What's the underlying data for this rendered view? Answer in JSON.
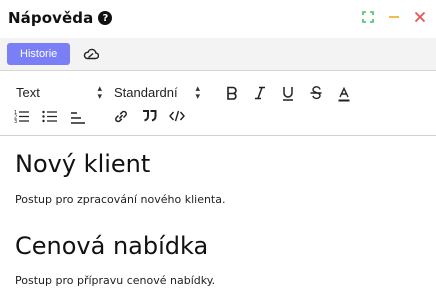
{
  "window": {
    "title": "Nápověda",
    "help_glyph": "?",
    "controls": [
      "expand-icon",
      "minimize-icon",
      "close-icon"
    ],
    "colors": {
      "expand": "#3cc46b",
      "minimize": "#f2b43a",
      "close": "#e8534f"
    }
  },
  "tabbar": {
    "history_label": "Historie",
    "cloud_icon": "cloud-icon",
    "accent": "#7b7ff5"
  },
  "toolbar": {
    "block_format": "Text",
    "font_size": "Standardní",
    "buttons": [
      "bold-icon",
      "italic-icon",
      "underline-icon",
      "strikethrough-icon",
      "text-color-icon",
      "ordered-list-icon",
      "bullet-list-icon",
      "align-icon",
      "link-icon",
      "quote-icon",
      "code-icon"
    ]
  },
  "content": {
    "sections": [
      {
        "heading": "Nový klient",
        "text": "Postup pro zpracování nového klienta."
      },
      {
        "heading": "Cenová nabídka",
        "text": "Postup pro přípravu cenové nabídky."
      }
    ]
  }
}
